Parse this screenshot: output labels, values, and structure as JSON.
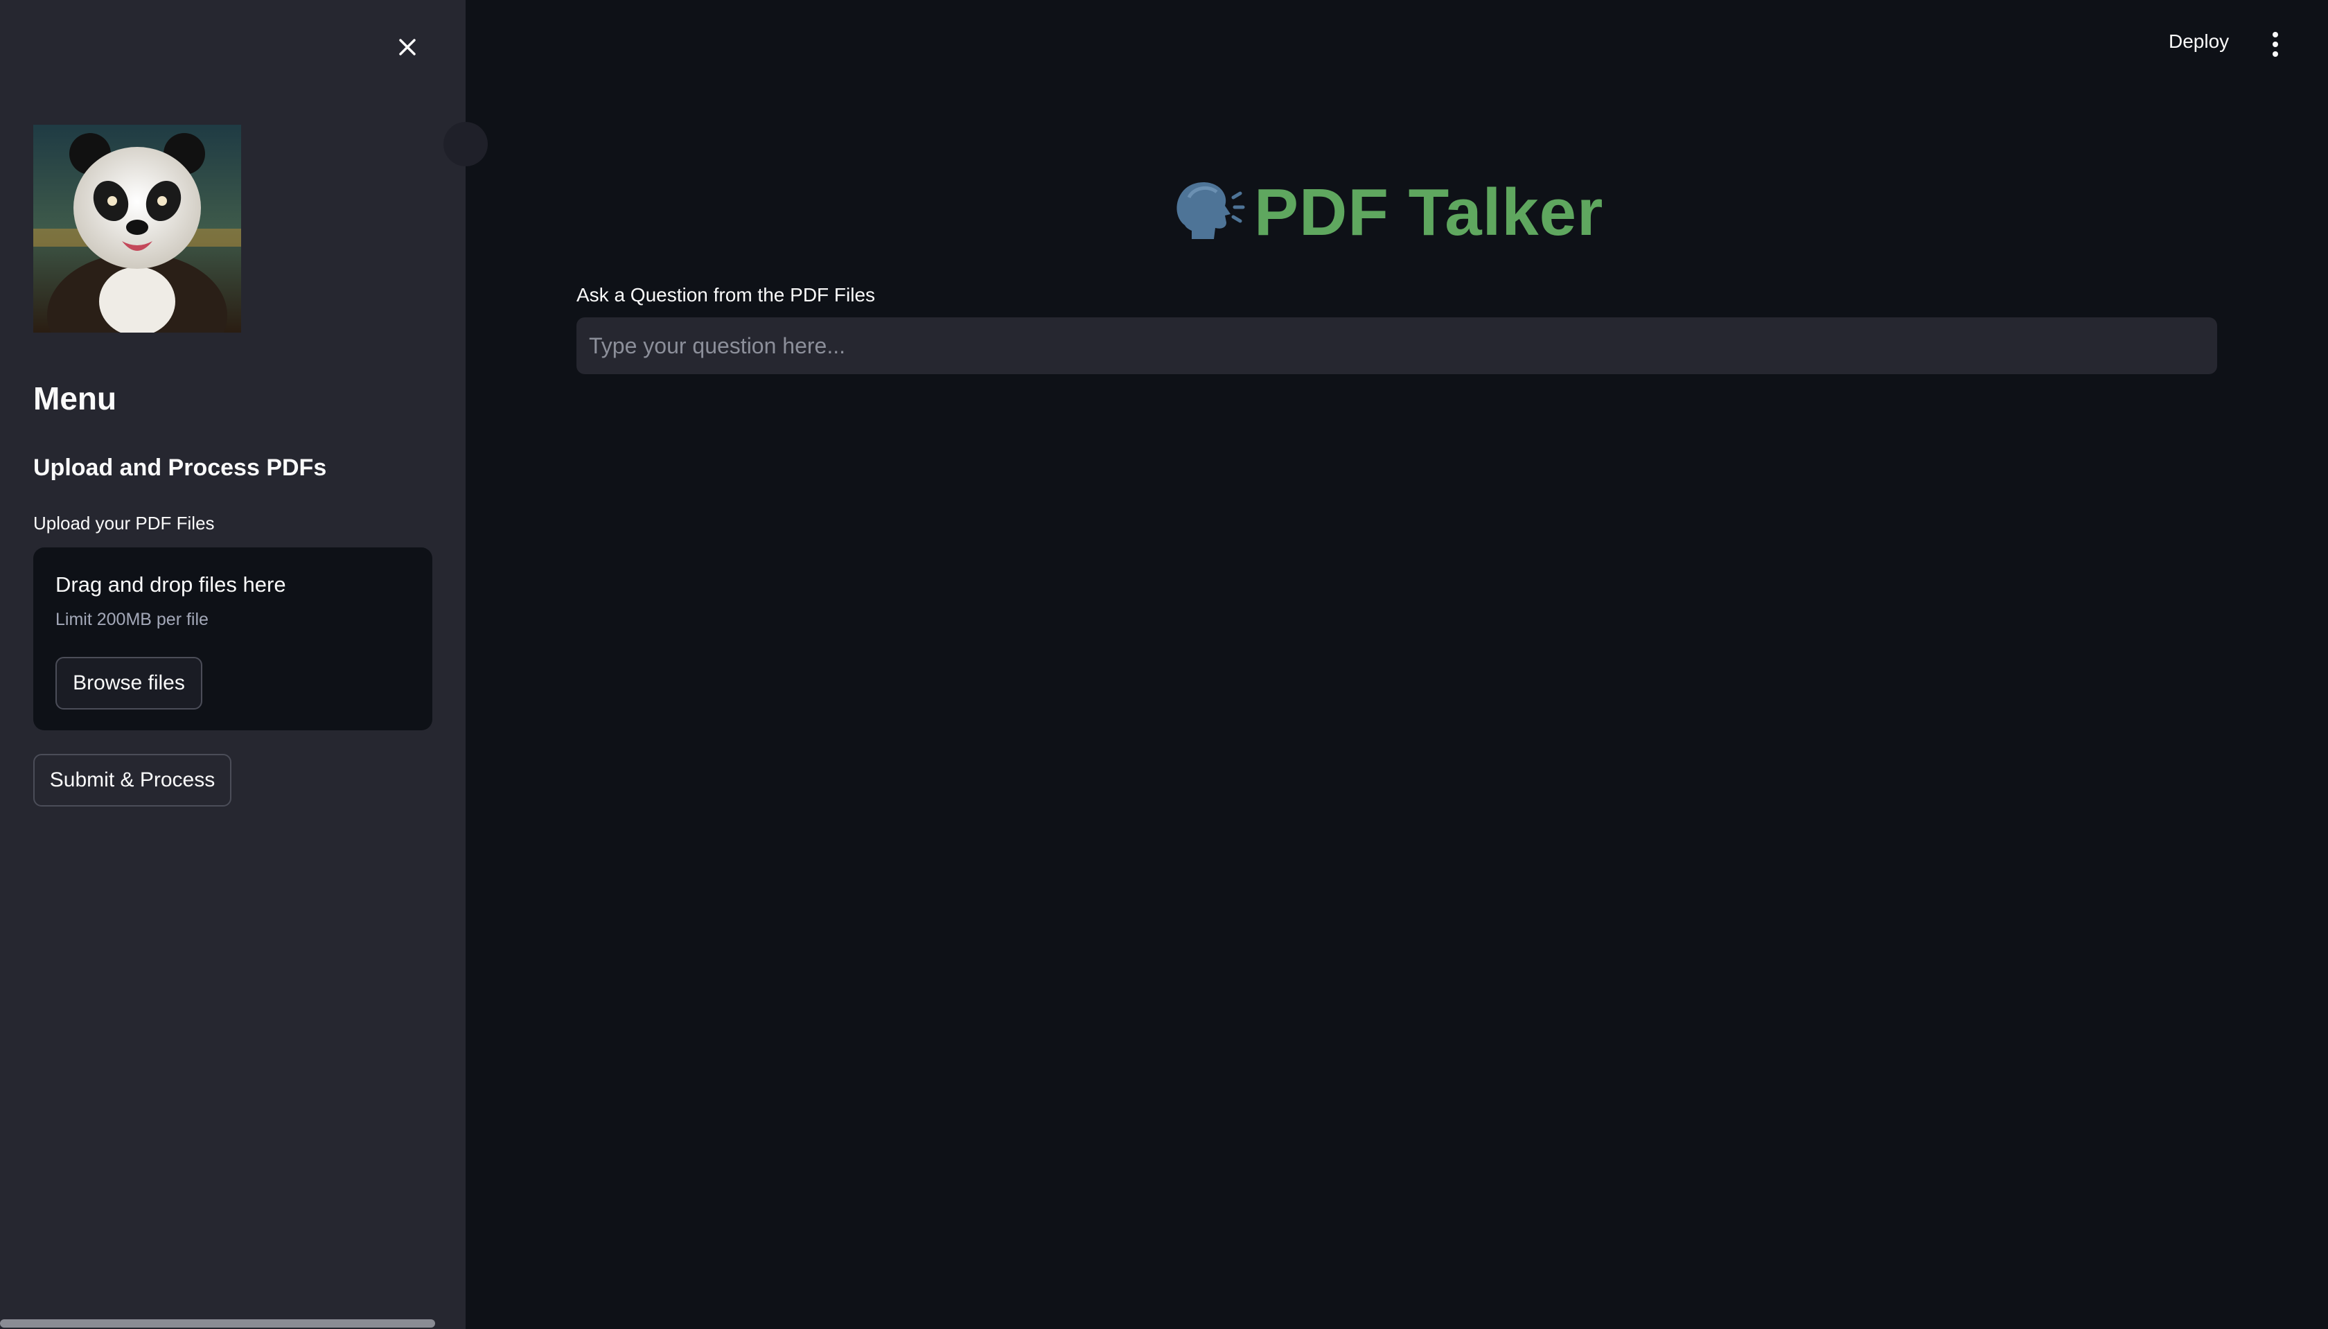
{
  "sidebar": {
    "menu_title": "Menu",
    "section_title": "Upload and Process PDFs",
    "upload_label": "Upload your PDF Files",
    "dropzone": {
      "title": "Drag and drop files here",
      "limit": "Limit 200MB per file",
      "browse_label": "Browse files"
    },
    "submit_label": "Submit & Process",
    "avatar_icon": "panda-avatar"
  },
  "header": {
    "deploy_label": "Deploy",
    "more_icon": "kebab-menu-icon"
  },
  "main": {
    "title": "PDF Talker",
    "title_icon": "speaking-head-icon",
    "question_label": "Ask a Question from the PDF Files",
    "question_value": "",
    "question_placeholder": "Type your question here..."
  },
  "colors": {
    "background": "#0e1117",
    "sidebar": "#262730",
    "title_green": "#5fa75f",
    "text": "#fafafa"
  }
}
